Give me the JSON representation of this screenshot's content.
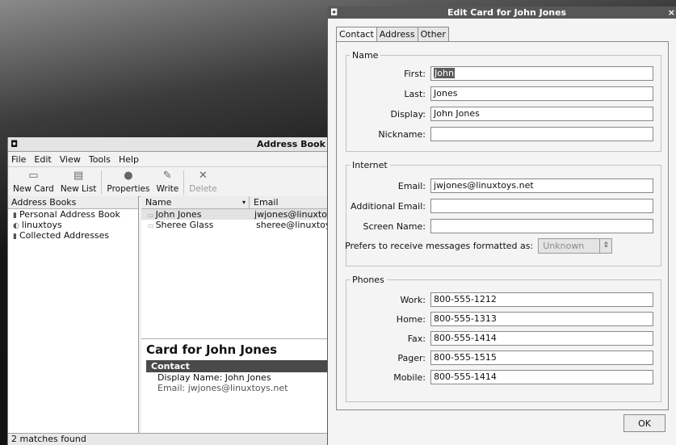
{
  "address_book": {
    "title": "Address Book",
    "menu": [
      "File",
      "Edit",
      "View",
      "Tools",
      "Help"
    ],
    "menu_mnemonics": [
      "F",
      "E",
      "V",
      "T",
      "H"
    ],
    "toolbar": {
      "new_card": "New Card",
      "new_list": "New List",
      "properties": "Properties",
      "write": "Write",
      "delete": "Delete"
    },
    "books_header": "Address Books",
    "books": [
      "Personal Address Book",
      "linuxtoys",
      "Collected Addresses"
    ],
    "list_columns": {
      "name": "Name",
      "email": "Email"
    },
    "contacts": [
      {
        "name": "John Jones",
        "email": "jwjones@linuxtoy"
      },
      {
        "name": "Sheree Glass",
        "email": "sheree@linuxtoy"
      }
    ],
    "card": {
      "title": "Card for John Jones",
      "section": "Contact",
      "display_name_line": "Display Name: John Jones",
      "email_line": "Email: jwjones@linuxtoys.net"
    },
    "status": "2 matches found"
  },
  "dialog": {
    "title": "Edit Card for John Jones",
    "close_glyph": "×",
    "tabs": [
      "Contact",
      "Address",
      "Other"
    ],
    "name_group": "Name",
    "first_label": "First:",
    "first_value": "John",
    "last_label": "Last:",
    "last_value": "Jones",
    "display_label": "Display:",
    "display_value": "John Jones",
    "nickname_label": "Nickname:",
    "nickname_value": "",
    "internet_group": "Internet",
    "email_label": "Email:",
    "email_value": "jwjones@linuxtoys.net",
    "additional_email_label": "Additional Email:",
    "additional_email_value": "",
    "screen_name_label": "Screen Name:",
    "screen_name_value": "",
    "prefers_label": "Prefers to receive messages formatted as:",
    "prefers_value": "Unknown",
    "phones_group": "Phones",
    "work_label": "Work:",
    "work_value": "800-555-1212",
    "home_label": "Home:",
    "home_value": "800-555-1313",
    "fax_label": "Fax:",
    "fax_value": "800-555-1414",
    "pager_label": "Pager:",
    "pager_value": "800-555-1515",
    "mobile_label": "Mobile:",
    "mobile_value": "800-555-1414",
    "ok": "OK"
  }
}
